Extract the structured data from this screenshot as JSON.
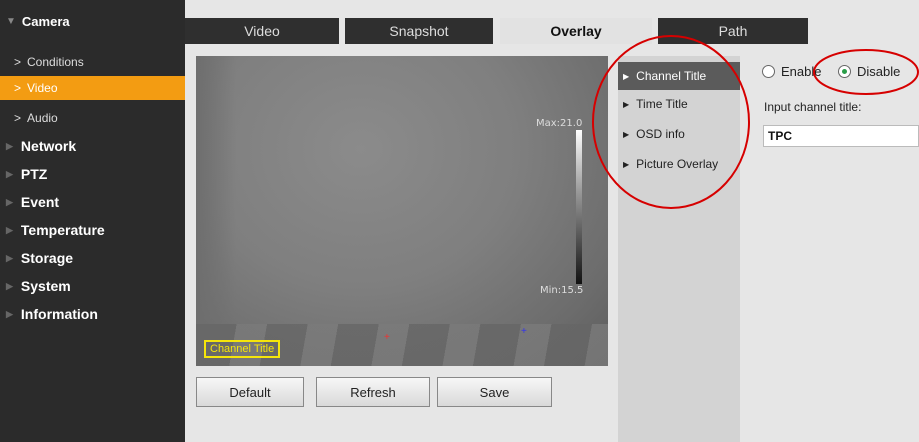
{
  "sidebar": {
    "top": {
      "label": "Camera",
      "icon": "triangle-down-icon"
    },
    "subitems": [
      {
        "label": "Conditions",
        "icon": "chevron-right-icon"
      },
      {
        "label": "Video",
        "icon": "chevron-right-icon",
        "active": true
      },
      {
        "label": "Audio",
        "icon": "chevron-right-icon"
      }
    ],
    "menu": [
      {
        "label": "Network"
      },
      {
        "label": "PTZ"
      },
      {
        "label": "Event"
      },
      {
        "label": "Temperature"
      },
      {
        "label": "Storage"
      },
      {
        "label": "System"
      },
      {
        "label": "Information"
      }
    ],
    "active_color": "#f39c12"
  },
  "tabs": [
    {
      "label": "Video"
    },
    {
      "label": "Snapshot"
    },
    {
      "label": "Overlay",
      "active": true
    },
    {
      "label": "Path"
    }
  ],
  "video": {
    "scale_max": "Max:21.0",
    "scale_min": "Min:15.5",
    "channel_title_overlay": "Channel Title",
    "overlay_color": "#f5e50a"
  },
  "overlay_menu": [
    {
      "label": "Channel Title",
      "active": true
    },
    {
      "label": "Time Title"
    },
    {
      "label": "OSD info"
    },
    {
      "label": "Picture Overlay"
    }
  ],
  "form": {
    "enable_label": "Enable",
    "disable_label": "Disable",
    "selected": "Disable",
    "input_label": "Input channel title:",
    "input_value": "TPC"
  },
  "buttons": {
    "default": "Default",
    "refresh": "Refresh",
    "save": "Save"
  },
  "annotation_color": "#d60000"
}
